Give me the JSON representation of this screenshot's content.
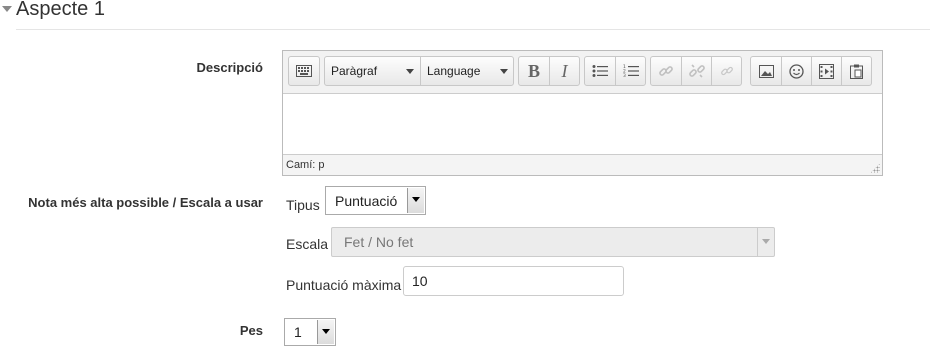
{
  "section": {
    "title": "Aspecte 1"
  },
  "fields": {
    "description_label": "Descripció",
    "grade_label": "Nota més alta possible / Escala a usar",
    "weight_label": "Pes"
  },
  "editor": {
    "paragraph_select": "Paràgraf",
    "language_select": "Language",
    "bold": "B",
    "italic": "I",
    "status_path": "Camí: p"
  },
  "grade": {
    "type_label": "Tipus",
    "type_value": "Puntuació",
    "scale_label": "Escala",
    "scale_value": "Fet / No fet",
    "max_label": "Puntuació màxima",
    "max_value": "10"
  },
  "weight": {
    "value": "1"
  },
  "icons": [
    "chevron-down-icon",
    "keyboard-toggle-icon",
    "bullet-list-icon",
    "numbered-list-icon",
    "link-icon",
    "unlink-icon",
    "anchor-link-icon",
    "image-icon",
    "emoticon-icon",
    "media-icon",
    "paste-icon"
  ]
}
